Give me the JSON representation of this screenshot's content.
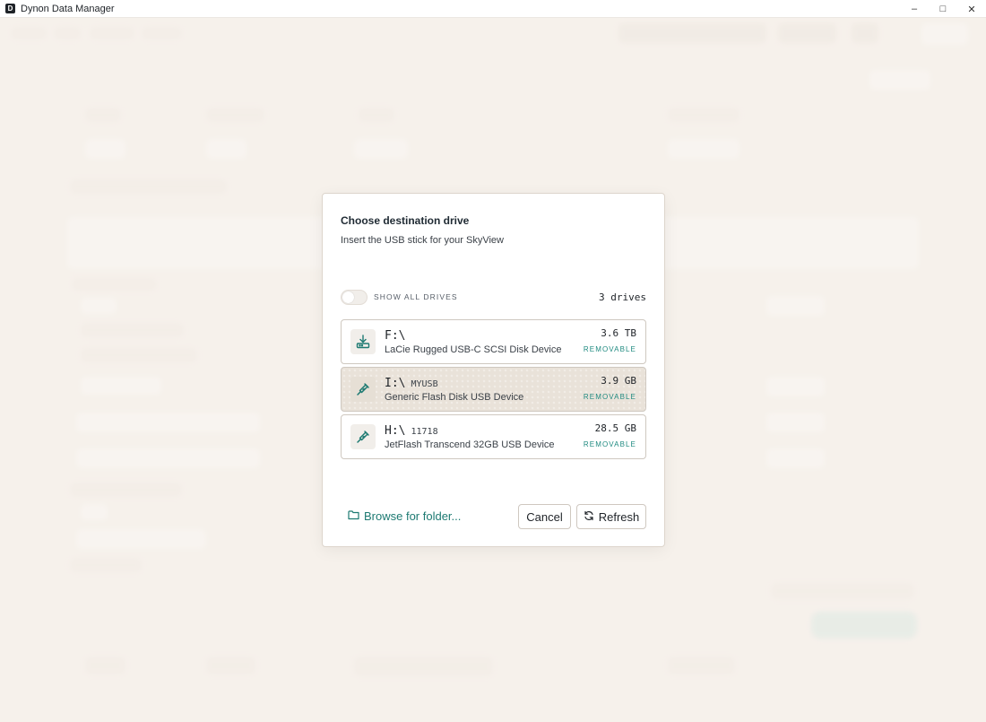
{
  "window": {
    "title": "Dynon Data Manager",
    "app_icon_letter": "D",
    "controls": {
      "minimize": "–",
      "maximize": "□",
      "close": "✕"
    }
  },
  "dialog": {
    "title": "Choose destination drive",
    "subtitle": "Insert the USB stick for your SkyView",
    "show_all_drives": {
      "label": "SHOW ALL DRIVES",
      "on": false
    },
    "drive_count": "3 drives",
    "drives": [
      {
        "letter": "F:\\",
        "label": "",
        "name": "LaCie Rugged USB-C SCSI Disk Device",
        "size": "3.6 TB",
        "tag": "REMOVABLE",
        "icon": "drive-download-icon",
        "selected": false
      },
      {
        "letter": "I:\\",
        "label": "MYUSB",
        "name": "Generic Flash Disk USB Device",
        "size": "3.9 GB",
        "tag": "REMOVABLE",
        "icon": "usb-icon",
        "selected": true
      },
      {
        "letter": "H:\\",
        "label": "11718",
        "name": "JetFlash Transcend 32GB USB Device",
        "size": "28.5 GB",
        "tag": "REMOVABLE",
        "icon": "usb-icon",
        "selected": false
      }
    ],
    "browse_label": "Browse for folder...",
    "cancel_label": "Cancel",
    "refresh_label": "Refresh"
  },
  "colors": {
    "accent": "#1d7a72",
    "tag": "#1f8a80",
    "background": "#f6f1eb",
    "selected": "#e9e2d9"
  }
}
